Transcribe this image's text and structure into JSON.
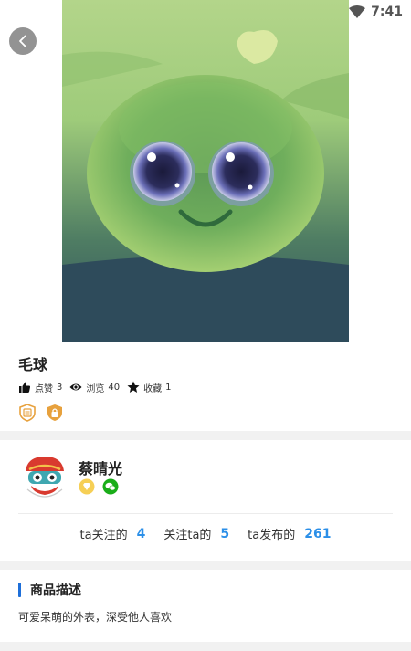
{
  "status": {
    "time": "7:41"
  },
  "product": {
    "title": "毛球",
    "stats": {
      "likes_label": "点赞",
      "likes_count": "3",
      "views_label": "浏览",
      "views_count": "40",
      "favorites_label": "收藏",
      "favorites_count": "1"
    }
  },
  "seller": {
    "name": "蔡晴光",
    "follow": {
      "following_label": "ta关注的",
      "following_count": "4",
      "followers_label": "关注ta的",
      "followers_count": "5",
      "posts_label": "ta发布的",
      "posts_count": "261"
    }
  },
  "description": {
    "heading": "商品描述",
    "text": "可爱呆萌的外表，深受他人喜欢"
  },
  "colors": {
    "accent_blue": "#2b8fe8",
    "section_bar": "#1e6fd9",
    "badge_gold": "#e7a13d",
    "wechat_green": "#1aad19"
  }
}
